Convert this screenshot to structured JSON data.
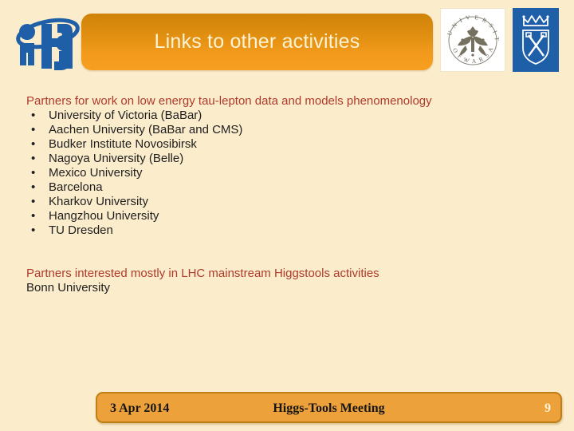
{
  "header": {
    "title": "Links to other activities",
    "logos": {
      "left": "ifj-institute-logo",
      "right_1": "university-of-warsaw-seal-logo",
      "right_1_text_top": "U N I V E R S I T Y",
      "right_1_text_bottom": "O F   W A R S A W",
      "right_2": "jagiellonian-university-crest-logo"
    }
  },
  "body": {
    "section_1": {
      "heading": "Partners for work on low energy tau-lepton data and models phenomenology",
      "bullet": "•",
      "items": [
        "University of Victoria (BaBar)",
        "Aachen University (BaBar and CMS)",
        "Budker Institute Novosibirsk",
        "Nagoya University (Belle)",
        "Mexico University",
        "Barcelona",
        "Kharkov University",
        "Hangzhou University",
        "TU Dresden"
      ]
    },
    "section_2": {
      "heading": "Partners interested mostly in LHC mainstream Higgstools activities",
      "lines": [
        "Bonn University"
      ]
    }
  },
  "footer": {
    "date": "3 Apr 2014",
    "meeting": "Higgs-Tools Meeting",
    "page_number": "9"
  },
  "colors": {
    "background": "#fbeccc",
    "banner_top": "#cf8309",
    "banner_bottom": "#f79f20",
    "banner_text": "#fdf3d4",
    "heading_text": "#b03a2a",
    "body_text": "#202020",
    "footer_bar": "#eda13a",
    "footer_border": "#c07f15",
    "logo_blue": "#1f5fa8"
  }
}
